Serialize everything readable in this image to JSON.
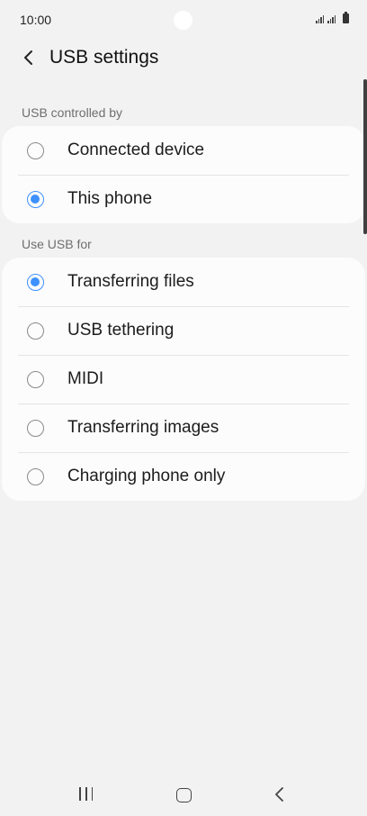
{
  "status_bar": {
    "time": "10:00"
  },
  "header": {
    "title": "USB settings",
    "back_icon": "chevron-left-icon"
  },
  "sections": [
    {
      "label": "USB controlled by",
      "options": [
        {
          "label": "Connected device",
          "selected": false
        },
        {
          "label": "This phone",
          "selected": true
        }
      ]
    },
    {
      "label": "Use USB for",
      "options": [
        {
          "label": "Transferring files",
          "selected": true
        },
        {
          "label": "USB tethering",
          "selected": false
        },
        {
          "label": "MIDI",
          "selected": false
        },
        {
          "label": "Transferring images",
          "selected": false
        },
        {
          "label": "Charging phone only",
          "selected": false
        }
      ]
    }
  ],
  "colors": {
    "accent": "#3e91ff",
    "background": "#f2f2f2",
    "card": "#fcfcfc"
  },
  "nav_bar": {
    "recents_icon": "recents-icon",
    "home_icon": "home-icon",
    "back_icon": "back-icon"
  }
}
